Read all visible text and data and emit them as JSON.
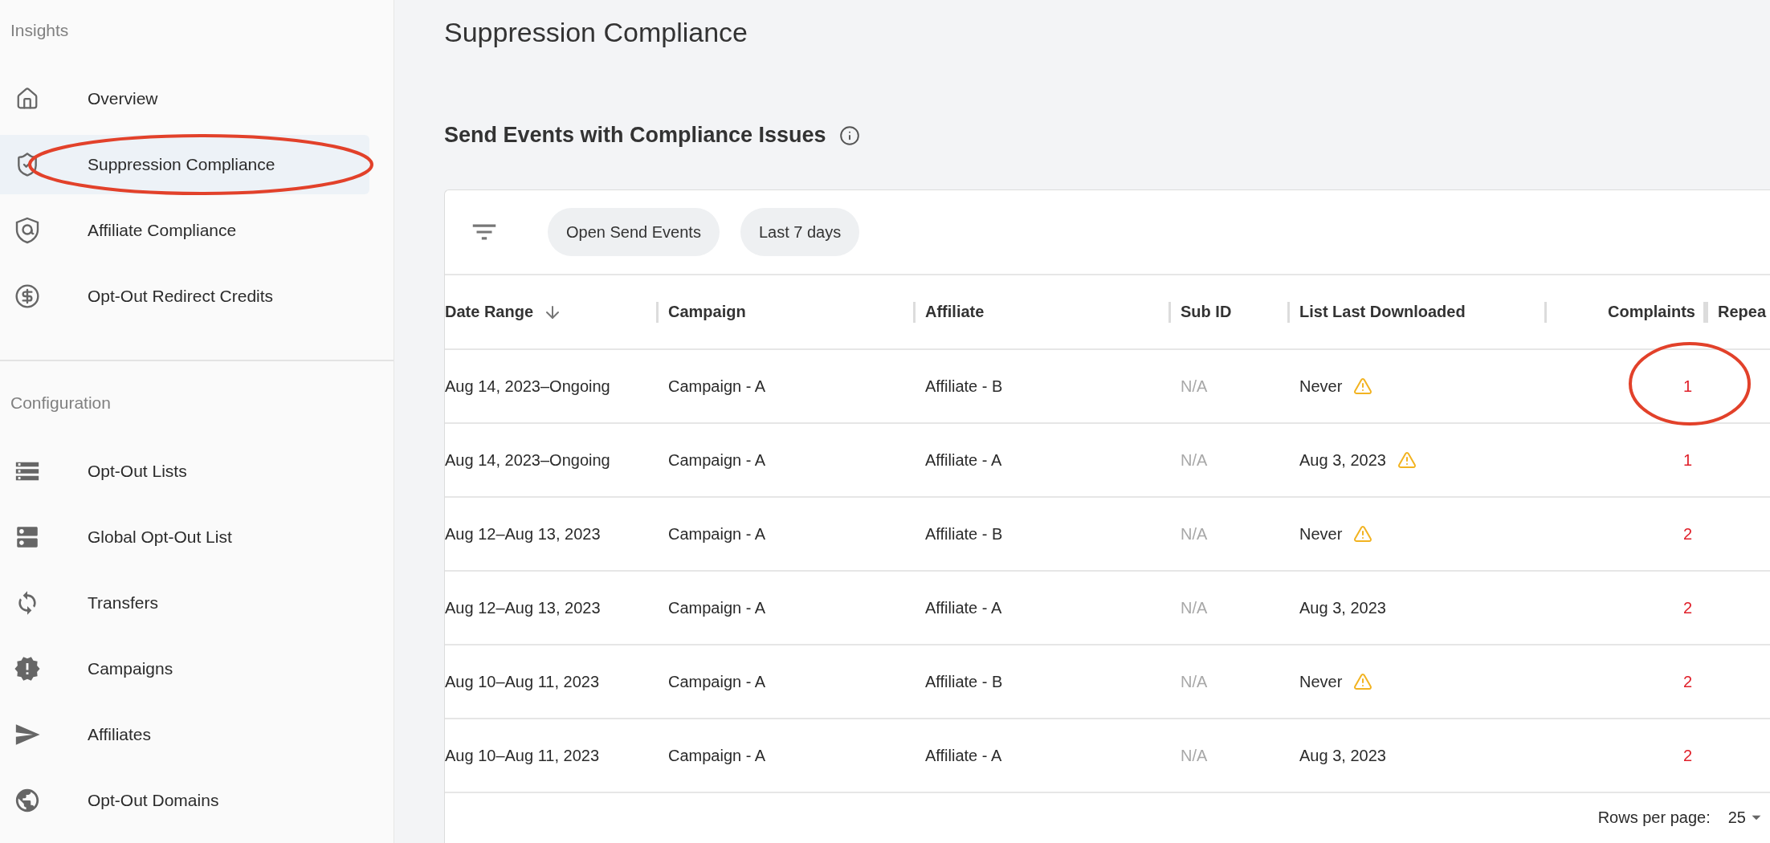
{
  "sidebar": {
    "sections": [
      {
        "title": "Insights",
        "items": [
          {
            "label": "Overview",
            "selected": false
          },
          {
            "label": "Suppression Compliance",
            "selected": true
          },
          {
            "label": "Affiliate Compliance",
            "selected": false
          },
          {
            "label": "Opt-Out Redirect Credits",
            "selected": false
          }
        ]
      },
      {
        "title": "Configuration",
        "items": [
          {
            "label": "Opt-Out Lists",
            "selected": false
          },
          {
            "label": "Global Opt-Out List",
            "selected": false
          },
          {
            "label": "Transfers",
            "selected": false
          },
          {
            "label": "Campaigns",
            "selected": false
          },
          {
            "label": "Affiliates",
            "selected": false
          },
          {
            "label": "Opt-Out Domains",
            "selected": false
          }
        ]
      }
    ]
  },
  "page_title": "Suppression Compliance",
  "section_title": "Send Events with Compliance Issues",
  "filters": [
    "Open Send Events",
    "Last 7 days"
  ],
  "table": {
    "columns": [
      "Date Range",
      "Campaign",
      "Affiliate",
      "Sub ID",
      "List Last Downloaded",
      "Complaints",
      "Repea"
    ],
    "rows": [
      {
        "date_range": "Aug 14, 2023–Ongoing",
        "campaign": "Campaign - A",
        "affiliate": "Affiliate - B",
        "sub_id": "N/A",
        "list_last_downloaded": "Never",
        "warning": true,
        "complaints": "1"
      },
      {
        "date_range": "Aug 14, 2023–Ongoing",
        "campaign": "Campaign - A",
        "affiliate": "Affiliate - A",
        "sub_id": "N/A",
        "list_last_downloaded": "Aug 3, 2023",
        "warning": true,
        "complaints": "1"
      },
      {
        "date_range": "Aug 12–Aug 13, 2023",
        "campaign": "Campaign - A",
        "affiliate": "Affiliate - B",
        "sub_id": "N/A",
        "list_last_downloaded": "Never",
        "warning": true,
        "complaints": "2"
      },
      {
        "date_range": "Aug 12–Aug 13, 2023",
        "campaign": "Campaign - A",
        "affiliate": "Affiliate - A",
        "sub_id": "N/A",
        "list_last_downloaded": "Aug 3, 2023",
        "warning": false,
        "complaints": "2"
      },
      {
        "date_range": "Aug 10–Aug 11, 2023",
        "campaign": "Campaign - A",
        "affiliate": "Affiliate - B",
        "sub_id": "N/A",
        "list_last_downloaded": "Never",
        "warning": true,
        "complaints": "2"
      },
      {
        "date_range": "Aug 10–Aug 11, 2023",
        "campaign": "Campaign - A",
        "affiliate": "Affiliate - A",
        "sub_id": "N/A",
        "list_last_downloaded": "Aug 3, 2023",
        "warning": false,
        "complaints": "2"
      }
    ]
  },
  "pagination": {
    "rows_per_page_label": "Rows per page:",
    "rows_per_page": "25"
  }
}
